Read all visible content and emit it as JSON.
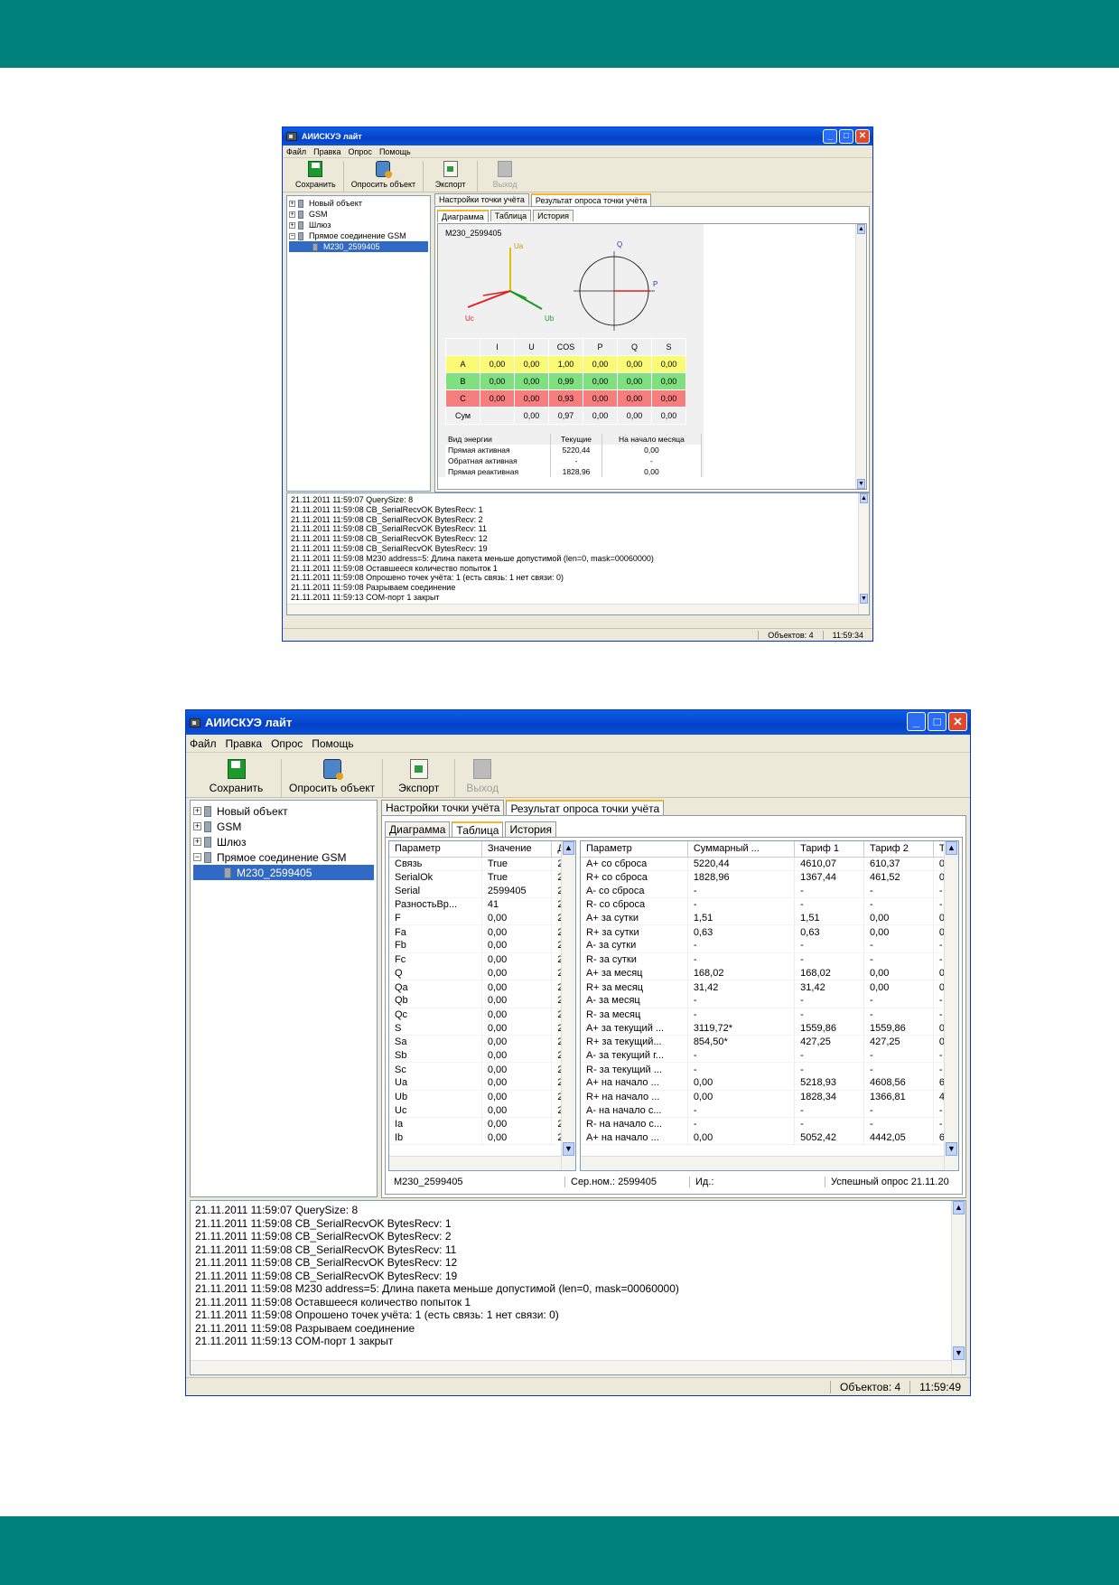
{
  "app_title": "АИИСКУЭ лайт",
  "menu": [
    "Файл",
    "Правка",
    "Опрос",
    "Помощь"
  ],
  "toolbar": {
    "save": "Сохранить",
    "poll": "Опросить объект",
    "export": "Экспорт",
    "exit": "Выход"
  },
  "tree": [
    "Новый объект",
    "GSM",
    "Шлюз",
    "Прямое соединение GSM",
    "M230_2599405"
  ],
  "tabs": {
    "settings": "Настройки точки учёта",
    "result": "Результат опроса точки учёта",
    "diagram": "Диаграмма",
    "table": "Таблица",
    "history": "История"
  },
  "diagram": {
    "device": "M230_2599405",
    "ua": "Ua",
    "ub": "Ub",
    "uc": "Uc",
    "q": "Q",
    "p": "P"
  },
  "phase_table": {
    "headers": [
      "I",
      "U",
      "COS",
      "P",
      "Q",
      "S"
    ],
    "rows": [
      {
        "label": "A",
        "values": [
          "0,00",
          "0,00",
          "1,00",
          "0,00",
          "0,00",
          "0,00"
        ]
      },
      {
        "label": "B",
        "values": [
          "0,00",
          "0,00",
          "0,99",
          "0,00",
          "0,00",
          "0,00"
        ]
      },
      {
        "label": "C",
        "values": [
          "0,00",
          "0,00",
          "0,93",
          "0,00",
          "0,00",
          "0,00"
        ]
      },
      {
        "label": "Сум",
        "values": [
          "",
          "0,00",
          "0,97",
          "0,00",
          "0,00",
          "0,00"
        ]
      }
    ]
  },
  "energy_table": {
    "headers": [
      "Вид энергии",
      "Текущие",
      "На начало месяца"
    ],
    "rows": [
      [
        "Прямая активная",
        "5220,44",
        "0,00"
      ],
      [
        "Обратная активная",
        "-",
        "-"
      ],
      [
        "Прямая реактивная",
        "1828,96",
        "0,00"
      ]
    ]
  },
  "params": {
    "headers": [
      "Параметр",
      "Значение",
      "Д"
    ],
    "rows": [
      [
        "Связь",
        "True",
        "2"
      ],
      [
        "SerialOk",
        "True",
        "2"
      ],
      [
        "Serial",
        "2599405",
        "2"
      ],
      [
        "РазностьВр...",
        "41",
        "2"
      ],
      [
        "F",
        "0,00",
        "2"
      ],
      [
        "Fa",
        "0,00",
        "2"
      ],
      [
        "Fb",
        "0,00",
        "2"
      ],
      [
        "Fc",
        "0,00",
        "2"
      ],
      [
        "Q",
        "0,00",
        "2"
      ],
      [
        "Qa",
        "0,00",
        "2"
      ],
      [
        "Qb",
        "0,00",
        "2"
      ],
      [
        "Qc",
        "0,00",
        "2"
      ],
      [
        "S",
        "0,00",
        "2"
      ],
      [
        "Sa",
        "0,00",
        "2"
      ],
      [
        "Sb",
        "0,00",
        "2"
      ],
      [
        "Sc",
        "0,00",
        "2"
      ],
      [
        "Ua",
        "0,00",
        "2"
      ],
      [
        "Ub",
        "0,00",
        "2"
      ],
      [
        "Uc",
        "0,00",
        "2"
      ],
      [
        "Ia",
        "0,00",
        "2"
      ],
      [
        "Ib",
        "0,00",
        "2"
      ]
    ]
  },
  "energy_grid": {
    "headers": [
      "Параметр",
      "Суммарный ...",
      "Тариф 1",
      "Тариф 2",
      "Т"
    ],
    "rows": [
      [
        "A+ со сброса",
        "5220,44",
        "4610,07",
        "610,37",
        "0"
      ],
      [
        "R+ со сброса",
        "1828,96",
        "1367,44",
        "461,52",
        "0"
      ],
      [
        "A- со сброса",
        "-",
        "-",
        "-",
        "-"
      ],
      [
        "R- со сброса",
        "-",
        "-",
        "-",
        "-"
      ],
      [
        "A+ за сутки",
        "1,51",
        "1,51",
        "0,00",
        "0"
      ],
      [
        "R+ за сутки",
        "0,63",
        "0,63",
        "0,00",
        "0"
      ],
      [
        "A- за сутки",
        "-",
        "-",
        "-",
        "-"
      ],
      [
        "R- за сутки",
        "-",
        "-",
        "-",
        "-"
      ],
      [
        "A+ за месяц",
        "168,02",
        "168,02",
        "0,00",
        "0"
      ],
      [
        "R+ за месяц",
        "31,42",
        "31,42",
        "0,00",
        "0"
      ],
      [
        "A- за месяц",
        "-",
        "-",
        "-",
        "-"
      ],
      [
        "R- за месяц",
        "-",
        "-",
        "-",
        "-"
      ],
      [
        "A+ за текущий ...",
        "3119,72*",
        "1559,86",
        "1559,86",
        "0"
      ],
      [
        "R+ за текущий...",
        "854,50*",
        "427,25",
        "427,25",
        "0"
      ],
      [
        "A- за текущий г...",
        "-",
        "-",
        "-",
        "-"
      ],
      [
        "R- за текущий ...",
        "-",
        "-",
        "-",
        "-"
      ],
      [
        "A+ на начало ...",
        "0,00",
        "5218,93",
        "4608,56",
        "6"
      ],
      [
        "R+ на начало ...",
        "0,00",
        "1828,34",
        "1366,81",
        "4"
      ],
      [
        "A- на начало с...",
        "-",
        "-",
        "-",
        "-"
      ],
      [
        "R- на начало с...",
        "-",
        "-",
        "-",
        "-"
      ],
      [
        "A+ на начало ...",
        "0,00",
        "5052,42",
        "4442,05",
        "6"
      ]
    ]
  },
  "info": {
    "device": "M230_2599405",
    "serial": "Сер.ном.: 2599405",
    "id": "Ид.:",
    "status": "Успешный опрос 21.11.20"
  },
  "log": [
    "21.11.2011 11:59:07  QuerySize: 8",
    "21.11.2011 11:59:08  CB_SerialRecvOK BytesRecv: 1",
    "21.11.2011 11:59:08  CB_SerialRecvOK BytesRecv: 2",
    "21.11.2011 11:59:08  CB_SerialRecvOK BytesRecv: 11",
    "21.11.2011 11:59:08  CB_SerialRecvOK BytesRecv: 12",
    "21.11.2011 11:59:08  CB_SerialRecvOK BytesRecv: 19",
    "21.11.2011 11:59:08  M230 address=5:   Длина пакета меньше допустимой (len=0, mask=00060000)",
    "21.11.2011 11:59:08  Оставшееся количество попыток 1",
    "21.11.2011 11:59:08  Опрошено точек учёта: 1 (есть связь: 1  нет связи: 0)",
    "21.11.2011 11:59:08  Разрываем соединение",
    "21.11.2011 11:59:13  COM-порт 1 закрыт"
  ],
  "status": {
    "objects": "Объектов: 4",
    "time1": "11:59:34",
    "time2": "11:59:49"
  }
}
